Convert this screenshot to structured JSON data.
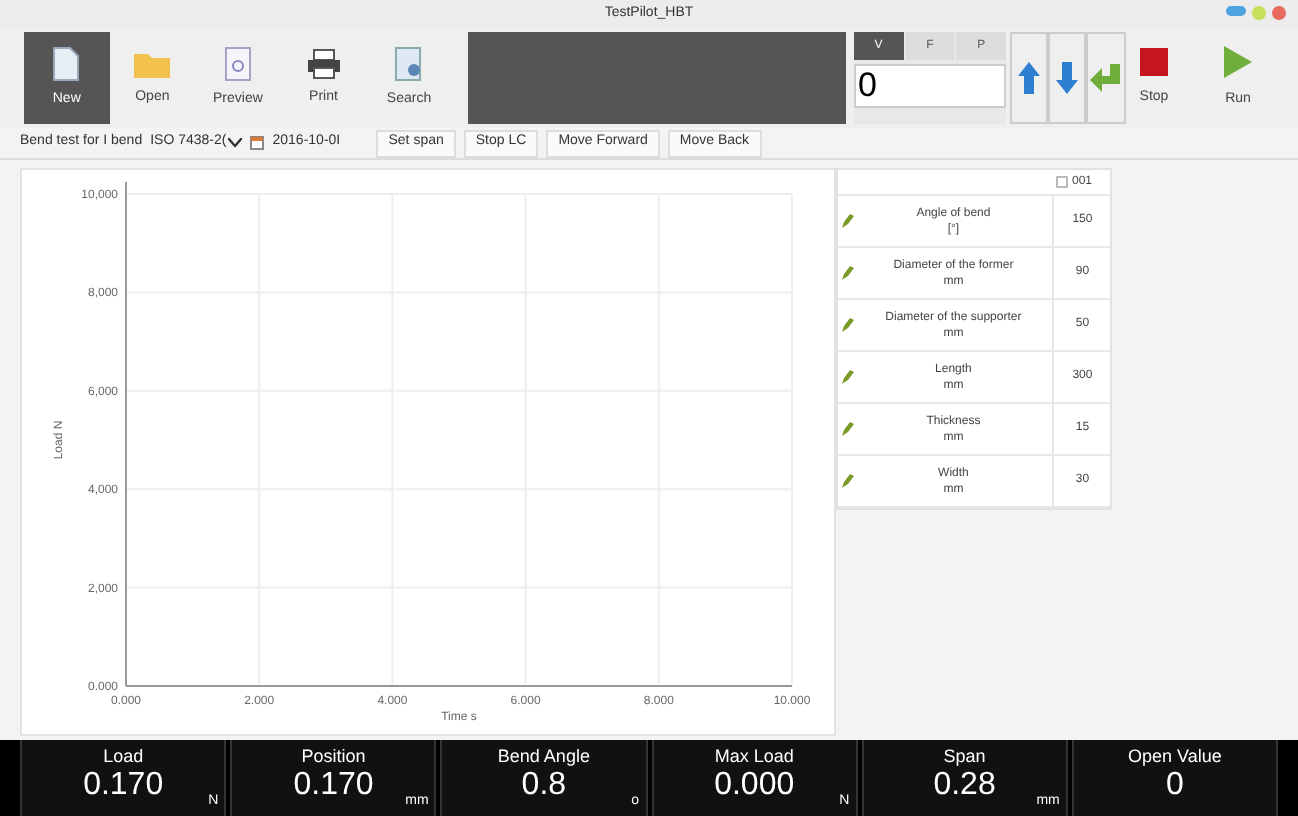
{
  "window": {
    "title": "TestPilot_HBT"
  },
  "toolbar": [
    {
      "label": "New",
      "selected": true
    },
    {
      "label": "Open",
      "selected": false
    },
    {
      "label": "Preview",
      "selected": false
    },
    {
      "label": "Print",
      "selected": false
    },
    {
      "label": "Search",
      "selected": false
    }
  ],
  "mode_tabs": [
    {
      "label": "V",
      "selected": true
    },
    {
      "label": "F",
      "selected": false
    },
    {
      "label": "P",
      "selected": false
    }
  ],
  "value_field": {
    "value": "0"
  },
  "run_controls": [
    {
      "label": "Stop",
      "kind": "stop"
    },
    {
      "label": "Run",
      "kind": "run"
    }
  ],
  "test_bar": {
    "test_name": "Bend test for I bend",
    "standard": "ISO 7438-2(",
    "date": "2016-10-0I",
    "buttons": [
      "Set span",
      "Stop LC",
      "Move Forward",
      "Move Back"
    ]
  },
  "chart": {
    "chart_data": {
      "type": "line",
      "grid": true,
      "xlabel": "Time s",
      "ylabel": "Load N",
      "xlim": [
        0,
        10
      ],
      "ylim": [
        0,
        10000
      ],
      "xticks": [
        {
          "value": 0,
          "label": "0.000"
        },
        {
          "value": 2,
          "label": "2.000"
        },
        {
          "value": 4,
          "label": "4.000"
        },
        {
          "value": 6,
          "label": "6.000"
        },
        {
          "value": 8,
          "label": "8.000"
        },
        {
          "value": 10,
          "label": "10.000"
        }
      ],
      "yticks": [
        {
          "value": 0,
          "label": "0.000"
        },
        {
          "value": 2000,
          "label": "2,000"
        },
        {
          "value": 4000,
          "label": "4,000"
        },
        {
          "value": 6000,
          "label": "6,000"
        },
        {
          "value": 8000,
          "label": "8,000"
        },
        {
          "value": 10000,
          "label": "10,000"
        }
      ]
    }
  },
  "parameters": {
    "column_header": {
      "label": "001",
      "checked": false
    },
    "rows": [
      {
        "name": "Angle of bend",
        "unit": "[°]",
        "value": "150"
      },
      {
        "name": "Diameter of the former",
        "unit": "mm",
        "value": "90"
      },
      {
        "name": "Diameter of the supporter",
        "unit": "mm",
        "value": "50"
      },
      {
        "name": "Length",
        "unit": "mm",
        "value": "300"
      },
      {
        "name": "Thickness",
        "unit": "mm",
        "value": "15"
      },
      {
        "name": "Width",
        "unit": "mm",
        "value": "30"
      }
    ]
  },
  "readouts": [
    {
      "label": "Load",
      "value": "0.170",
      "unit": "N"
    },
    {
      "label": "Position",
      "value": "0.170",
      "unit": "mm"
    },
    {
      "label": "Bend Angle",
      "value": "0.8",
      "unit": "o"
    },
    {
      "label": "Max Load",
      "value": "0.000",
      "unit": "N"
    },
    {
      "label": "Span",
      "value": "0.28",
      "unit": "mm"
    },
    {
      "label": "Open Value",
      "value": "0"
    }
  ]
}
